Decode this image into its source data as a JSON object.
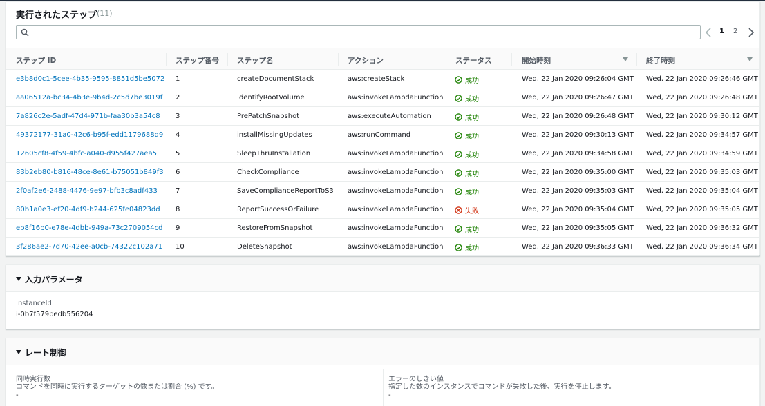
{
  "steps": {
    "title": "実行されたステップ",
    "count": "(11)",
    "search_placeholder": "",
    "pagination": {
      "pages": [
        "1",
        "2"
      ],
      "current": "1"
    },
    "columns": [
      "ステップ ID",
      "ステップ番号",
      "ステップ名",
      "アクション",
      "ステータス",
      "開始時刻",
      "終了時刻"
    ],
    "rows": [
      {
        "id": "e3b8d0c1-5cee-4b35-9595-8851d5be5072",
        "num": "1",
        "name": "createDocumentStack",
        "action": "aws:createStack",
        "status": "成功",
        "status_type": "success",
        "start": "Wed, 22 Jan 2020 09:26:04 GMT",
        "end": "Wed, 22 Jan 2020 09:26:46 GMT"
      },
      {
        "id": "aa06512a-bc34-4b3e-9b4d-2c5d7be3019f",
        "num": "2",
        "name": "IdentifyRootVolume",
        "action": "aws:invokeLambdaFunction",
        "status": "成功",
        "status_type": "success",
        "start": "Wed, 22 Jan 2020 09:26:47 GMT",
        "end": "Wed, 22 Jan 2020 09:26:48 GMT"
      },
      {
        "id": "7a826c2e-5adf-47d4-971b-faa30b3a54c8",
        "num": "3",
        "name": "PrePatchSnapshot",
        "action": "aws:executeAutomation",
        "status": "成功",
        "status_type": "success",
        "start": "Wed, 22 Jan 2020 09:26:48 GMT",
        "end": "Wed, 22 Jan 2020 09:30:12 GMT"
      },
      {
        "id": "49372177-31a0-42c6-b95f-edd1179688d9",
        "num": "4",
        "name": "installMissingUpdates",
        "action": "aws:runCommand",
        "status": "成功",
        "status_type": "success",
        "start": "Wed, 22 Jan 2020 09:30:13 GMT",
        "end": "Wed, 22 Jan 2020 09:34:57 GMT"
      },
      {
        "id": "12605cf8-4f59-4bfc-a040-d955f427aea5",
        "num": "5",
        "name": "SleepThruInstallation",
        "action": "aws:invokeLambdaFunction",
        "status": "成功",
        "status_type": "success",
        "start": "Wed, 22 Jan 2020 09:34:58 GMT",
        "end": "Wed, 22 Jan 2020 09:34:59 GMT"
      },
      {
        "id": "83b2eb80-b816-48ce-8e61-b75051b849f3",
        "num": "6",
        "name": "CheckCompliance",
        "action": "aws:invokeLambdaFunction",
        "status": "成功",
        "status_type": "success",
        "start": "Wed, 22 Jan 2020 09:35:00 GMT",
        "end": "Wed, 22 Jan 2020 09:35:03 GMT"
      },
      {
        "id": "2f0af2e6-2488-4476-9e97-bfb3c8adf433",
        "num": "7",
        "name": "SaveComplianceReportToS3",
        "action": "aws:invokeLambdaFunction",
        "status": "成功",
        "status_type": "success",
        "start": "Wed, 22 Jan 2020 09:35:03 GMT",
        "end": "Wed, 22 Jan 2020 09:35:04 GMT"
      },
      {
        "id": "80b1a0e3-ef20-4df9-b244-625fe04823dd",
        "num": "8",
        "name": "ReportSuccessOrFailure",
        "action": "aws:invokeLambdaFunction",
        "status": "失敗",
        "status_type": "failed",
        "start": "Wed, 22 Jan 2020 09:35:04 GMT",
        "end": "Wed, 22 Jan 2020 09:35:05 GMT"
      },
      {
        "id": "eb8f16b0-e78e-4dbb-949a-73c2709054cd",
        "num": "9",
        "name": "RestoreFromSnapshot",
        "action": "aws:invokeLambdaFunction",
        "status": "成功",
        "status_type": "success",
        "start": "Wed, 22 Jan 2020 09:35:05 GMT",
        "end": "Wed, 22 Jan 2020 09:36:32 GMT"
      },
      {
        "id": "3f286ae2-7d70-42ee-a0cb-74322c102a71",
        "num": "10",
        "name": "DeleteSnapshot",
        "action": "aws:invokeLambdaFunction",
        "status": "成功",
        "status_type": "success",
        "start": "Wed, 22 Jan 2020 09:36:33 GMT",
        "end": "Wed, 22 Jan 2020 09:36:34 GMT"
      }
    ]
  },
  "input_params": {
    "title": "入力パラメータ",
    "key": "InstanceId",
    "value": "i-0b7f579bedb556204"
  },
  "rate_control": {
    "title": "レート制御",
    "concurrency": {
      "label": "同時実行数",
      "description": "コマンドを同時に実行するターゲットの数または割合 (%) です。",
      "value": "-"
    },
    "error_threshold": {
      "label": "エラーのしきい値",
      "description": "指定した数のインスタンスでコマンドが失敗した後、実行を停止します。",
      "value": "-"
    }
  },
  "colors": {
    "link": "#0073bb",
    "success": "#1d8102",
    "failed": "#d13212"
  }
}
